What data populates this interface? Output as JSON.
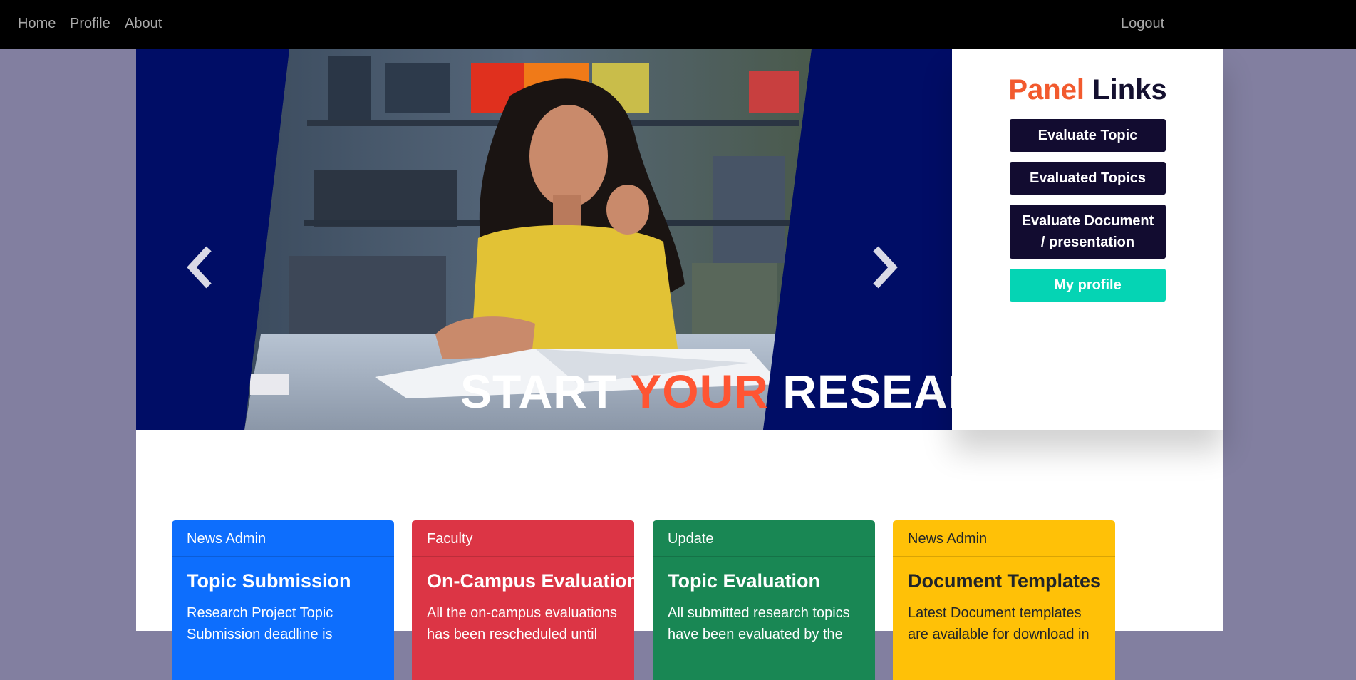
{
  "nav": {
    "home": "Home",
    "profile": "Profile",
    "about": "About",
    "logout": "Logout"
  },
  "hero": {
    "caption_start": "START ",
    "caption_your": "YOUR",
    "caption_end": " RESEARCH",
    "prev_icon": "chevron-left-icon",
    "next_icon": "chevron-right-icon"
  },
  "panel": {
    "title_part1": "Panel",
    "title_part2": "Links",
    "buttons": [
      {
        "label": "Evaluate Topic"
      },
      {
        "label": "Evaluated Topics"
      },
      {
        "label": "Evaluate Document / presentation"
      },
      {
        "label": "My profile"
      }
    ]
  },
  "cards": [
    {
      "header": "News Admin",
      "title": "Topic Submission",
      "text": "Research Project Topic Submission deadline is"
    },
    {
      "header": "Faculty",
      "title": "On-Campus Evaluations",
      "text": "All the on-campus evaluations has been rescheduled until"
    },
    {
      "header": "Update",
      "title": "Topic Evaluation",
      "text": "All submitted research topics have been evaluated by the"
    },
    {
      "header": "News Admin",
      "title": "Document Templates",
      "text": "Latest Document templates are available for download in"
    }
  ],
  "colors": {
    "navbar": "#000000",
    "page_bg": "#827fa0",
    "hero_bg": "#000d66",
    "accent_orange": "#f25a2e",
    "panel_button": "#120c30",
    "panel_button_teal": "#05d4b4",
    "card_blue": "#0d6efd",
    "card_red": "#dc3545",
    "card_green": "#198754",
    "card_yellow": "#ffc107"
  }
}
